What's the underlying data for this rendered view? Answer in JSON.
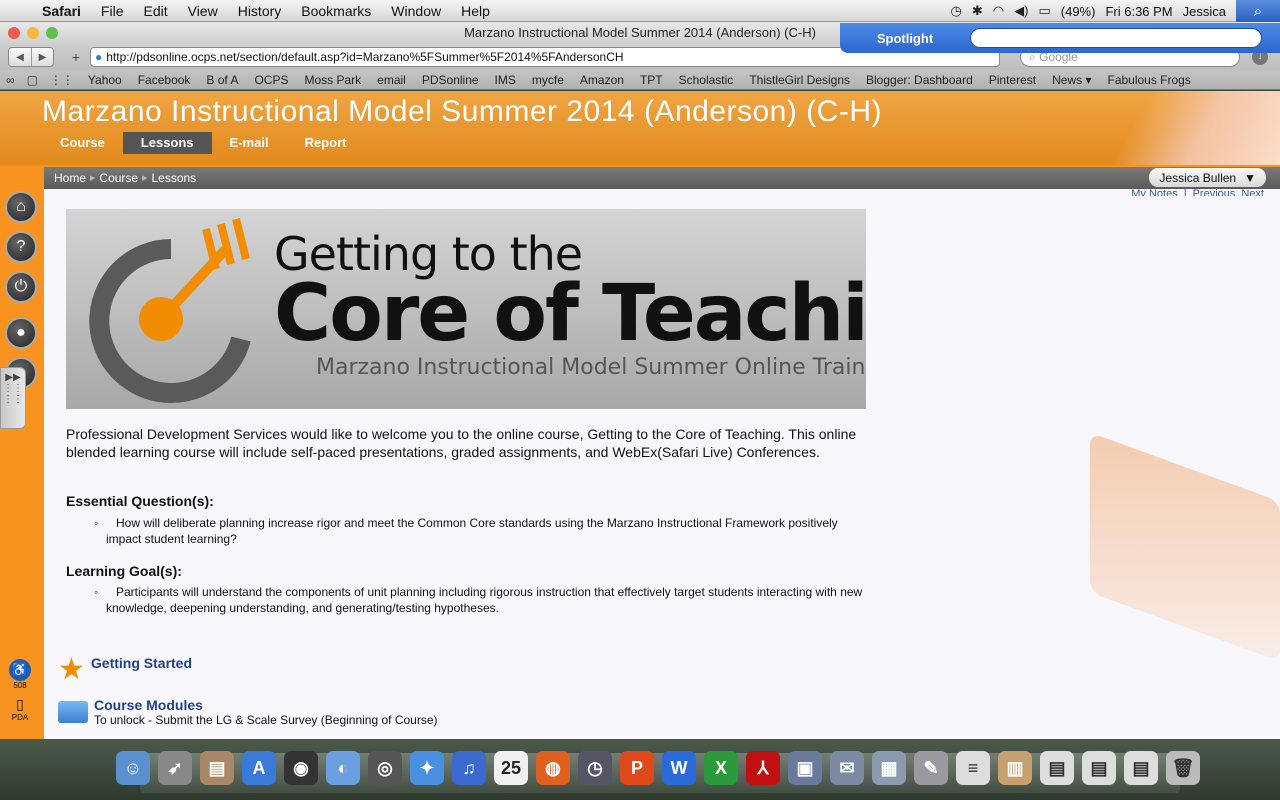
{
  "menubar": {
    "app": "Safari",
    "menus": [
      "File",
      "Edit",
      "View",
      "History",
      "Bookmarks",
      "Window",
      "Help"
    ],
    "battery": "(49%)",
    "clock": "Fri 6:36 PM",
    "user": "Jessica"
  },
  "spotlight": {
    "label": "Spotlight",
    "value": ""
  },
  "window": {
    "title": "Marzano Instructional Model Summer 2014 (Anderson) (C-H)"
  },
  "toolbar": {
    "url": "http://pdsonline.ocps.net/section/default.asp?id=Marzano%5FSummer%5F2014%5FAndersonCH",
    "search_placeholder": "Google"
  },
  "bookmarks": [
    "Yahoo",
    "Facebook",
    "B of A",
    "OCPS",
    "Moss Park",
    "email",
    "PDSonline",
    "IMS",
    "mycfe",
    "Amazon",
    "TPT",
    "Scholastic",
    "ThistleGirl Designs",
    "Blogger: Dashboard",
    "Pinterest",
    "News ▾",
    "Fabulous Frogs"
  ],
  "course": {
    "title": "Marzano Instructional Model Summer 2014 (Anderson) (C-H)",
    "tabs": [
      "Course",
      "Lessons",
      "E-mail",
      "Report"
    ],
    "active_tab": "Lessons"
  },
  "breadcrumb": [
    "Home",
    "Course",
    "Lessons"
  ],
  "user_menu": "Jessica Bullen",
  "top_links": [
    "My Notes",
    "|",
    "Previous",
    "Next"
  ],
  "sidebar": {
    "label_508": "508",
    "label_pda": "PDA"
  },
  "logo": {
    "line1": "Getting to the",
    "line2": "Core of Teaching",
    "line3": "Marzano Instructional Model Summer Online Training"
  },
  "intro": "Professional Development Services would like to welcome you to the online course, Getting to the Core of Teaching. This online blended learning course will include self-paced presentations, graded assignments, and WebEx(Safari Live) Conferences.",
  "essential": {
    "heading": "Essential Question(s):",
    "bullet": "How will deliberate planning increase rigor and meet the Common Core standards using the Marzano Instructional Framework positively impact student learning?"
  },
  "goal": {
    "heading": "Learning Goal(s):",
    "bullet": "Participants will understand the components of unit planning including rigorous instruction that effectively target students interacting with new knowledge, deepening understanding, and generating/testing hypotheses."
  },
  "items": {
    "getting_started": "Getting Started",
    "modules_title": "Course Modules",
    "modules_sub": "To unlock - Submit the LG & Scale Survey (Beginning of Course)"
  },
  "dock": {
    "calendar_day": "25"
  }
}
